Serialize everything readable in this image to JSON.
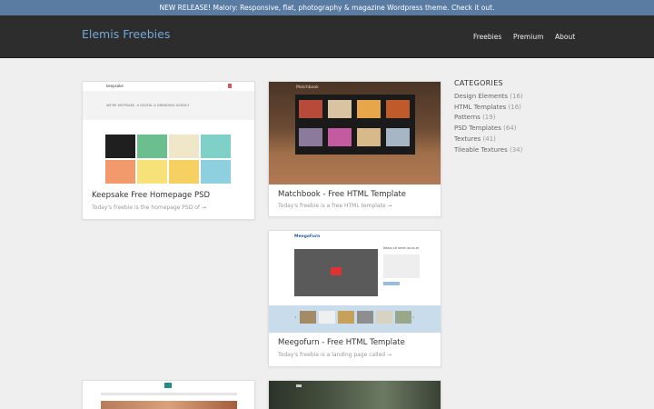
{
  "announcement": "NEW RELEASE! Malory: Responsive, flat, photography & magazine Wordpress theme. Check it out.",
  "header": {
    "logo": "Elemis Freebies",
    "nav": [
      "Freebies",
      "Premium",
      "About"
    ]
  },
  "cards": [
    {
      "title": "Keepsake Free Homepage PSD",
      "desc": "Today's freebie is the homepage PSD of →"
    },
    {
      "title": "Matchbook - Free HTML Template",
      "desc": "Today's freebie is a free HTML template →"
    },
    {
      "title": "Meegofurn - Free HTML Template",
      "desc": "Today's freebie is a landing page called →"
    }
  ],
  "sidebar": {
    "heading": "CATEGORIES",
    "items": [
      {
        "label": "Design Elements",
        "count": "(16)"
      },
      {
        "label": "HTML Templates",
        "count": "(16)"
      },
      {
        "label": "Patterns",
        "count": "(19)"
      },
      {
        "label": "PSD Templates",
        "count": "(64)"
      },
      {
        "label": "Textures",
        "count": "(41)"
      },
      {
        "label": "Tileable Textures",
        "count": "(34)"
      }
    ]
  },
  "thumbs": {
    "keepsake_brand": "keepsake",
    "keepsake_tagline": "WE'RE KEEPSAKE, A DIGITAL & BRANDING AGENCY",
    "matchbook_brand": "Matchbook",
    "meegofurn_brand": "MeegoFurn",
    "meegofurn_heading": "Natus sit amet lacus et"
  },
  "colors": {
    "accent": "#74a8d9",
    "announce_bg": "#5a7ca3",
    "header_bg": "#2d2d2d"
  }
}
